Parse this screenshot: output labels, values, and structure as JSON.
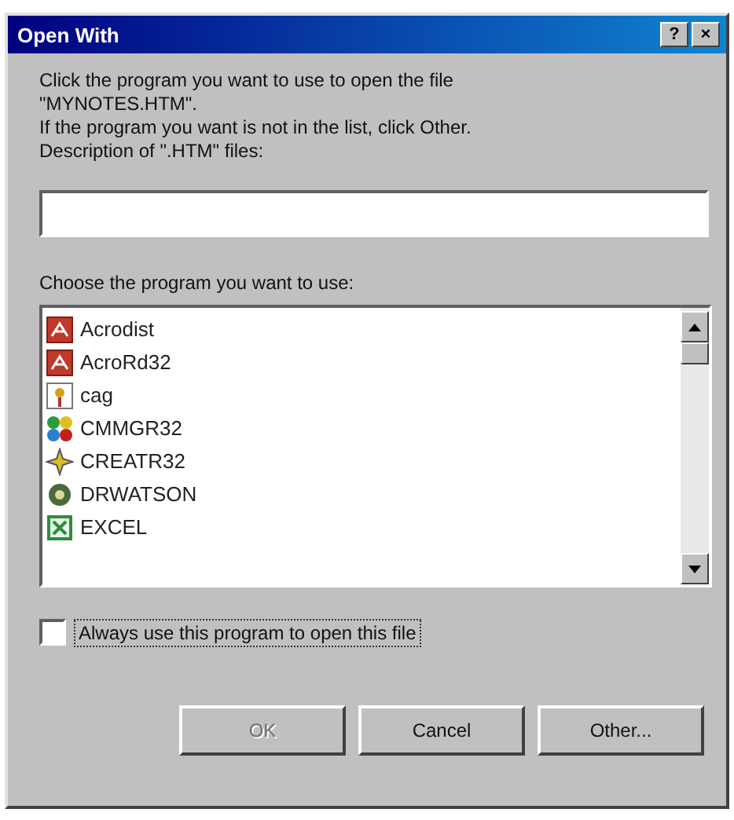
{
  "window": {
    "title": "Open With",
    "title_buttons": [
      "?",
      "×"
    ]
  },
  "intro": [
    "Click the program you want to use to open the file \"MYNOTES.HTM\".",
    "If the program you want is not in the list, click Other."
  ],
  "description_label": "Description of \".HTM\" files:",
  "programs_label": "Choose the program you want to use:",
  "programs": [
    {
      "name": "Acrodist",
      "kind": "pdf",
      "selected": false
    },
    {
      "name": "AcroRd32",
      "kind": "pdf",
      "selected": false
    },
    {
      "name": "cag",
      "kind": "cag",
      "selected": false
    },
    {
      "name": "CMMGR32",
      "kind": "cmm",
      "selected": false
    },
    {
      "name": "CREATR32",
      "kind": "creatr",
      "selected": false
    },
    {
      "name": "DRWATSON",
      "kind": "doctor",
      "selected": false
    },
    {
      "name": "EXCEL",
      "kind": "excel",
      "selected": false
    }
  ],
  "always_use": {
    "label": "Always use this program to open this file",
    "checked": false
  },
  "buttons": [
    {
      "label": "OK",
      "disabled": true
    },
    {
      "label": "Cancel",
      "disabled": false
    },
    {
      "label": "Other...",
      "disabled": false
    }
  ]
}
